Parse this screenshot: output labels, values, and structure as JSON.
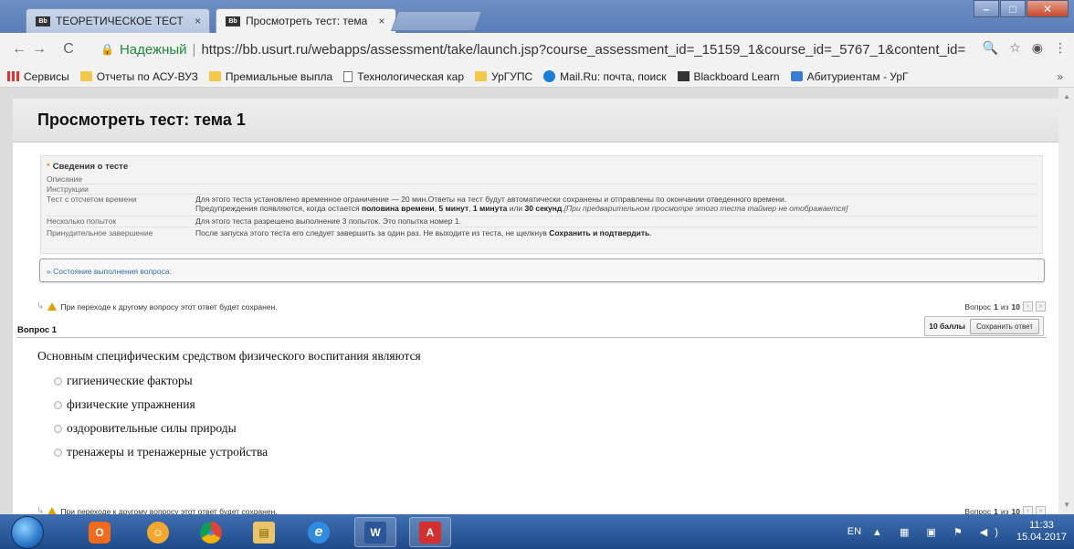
{
  "browser": {
    "tabs": [
      {
        "favicon": "Bb",
        "title": "ТЕОРЕТИЧЕСКОЕ ТЕСТИ",
        "close": "×"
      },
      {
        "favicon": "Bb",
        "title": "Просмотреть тест: тема",
        "close": "×"
      }
    ],
    "window_buttons": {
      "minimize": "–",
      "maximize": "□",
      "close": "✕"
    },
    "nav": {
      "back": "←",
      "forward": "→",
      "reload": "C"
    },
    "address": {
      "secure_label": "Надежный",
      "separator": "|",
      "url": "https://bb.usurt.ru/webapps/assessment/take/launch.jsp?course_assessment_id=_15159_1&course_id=_5767_1&content_id="
    },
    "toolbar_icons": {
      "zoom": "🔍",
      "star": "☆",
      "extension": "◉",
      "menu": "⋮"
    },
    "bookmarks": [
      {
        "icon": "apps-icon",
        "label": "Сервисы"
      },
      {
        "icon": "folder-icon",
        "label": "Отчеты по АСУ-ВУЗ"
      },
      {
        "icon": "folder-icon",
        "label": "Премиальные выпла"
      },
      {
        "icon": "page-icon",
        "label": "Технологическая кар"
      },
      {
        "icon": "folder-icon",
        "label": "УрГУПС"
      },
      {
        "icon": "mail-icon",
        "label": "Mail.Ru: почта, поиск"
      },
      {
        "icon": "blackboard-icon",
        "label": "Blackboard Learn"
      },
      {
        "icon": "abiturient-icon",
        "label": "Абитуриентам - УрГ"
      }
    ],
    "bookmarks_more": "»"
  },
  "page": {
    "title": "Просмотреть тест: тема 1",
    "info": {
      "heading": "Сведения о тесте",
      "rows": [
        {
          "key": "Описание",
          "value": ""
        },
        {
          "key": "Инструкции",
          "value": ""
        },
        {
          "key": "Тест с отсчетом времени",
          "value": "Для этого теста установлено временное ограничение — 20 мин.Ответы на тест будут автоматически сохранены и отправлены по окончании отведенного времени.",
          "value2_prefix": "Предупреждения появляются, когда остается ",
          "value2_b1": "половина времени",
          "value2_sep1": ", ",
          "value2_b2": "5 минут",
          "value2_sep2": ", ",
          "value2_b3": "1 минута",
          "value2_sep3": " или ",
          "value2_b4": "30 секунд",
          "value2_sep4": ".",
          "value2_italic": "[При предварительном просмотре этого теста таймер не отображается]"
        },
        {
          "key": "Несколько попыток",
          "value": "Для этого теста разрешено выполнение 3 попыток. Это попытка номер 1."
        },
        {
          "key": "Принудительное завершение",
          "value": "После запуска этого теста его следует завершить за один раз. Не выходите из теста, не щелкнув ",
          "value_bold": "Сохранить и подтвердить",
          "value_end": "."
        }
      ]
    },
    "status_toggle": "» Состояние выполнения вопроса:",
    "warning": "При переходе к другому вопросу этот ответ будет сохранен.",
    "pager": {
      "prefix": "Вопрос",
      "current": "1",
      "of": "из",
      "total": "10",
      "next": "›",
      "last": "»"
    },
    "question": {
      "heading": "Вопрос 1",
      "points": "10 баллы",
      "save_label": "Сохранить ответ",
      "text": "Основным специфическим средством физического воспитания являются",
      "options": [
        "гигиенические факторы",
        "физические упражнения",
        "оздоровительные силы природы",
        "тренажеры и тренажерные устройства"
      ]
    }
  },
  "taskbar": {
    "apps": [
      {
        "name": "origin",
        "glyph": "O"
      },
      {
        "name": "messenger",
        "glyph": "☺"
      },
      {
        "name": "chrome",
        "glyph": "●"
      },
      {
        "name": "explorer",
        "glyph": "▤"
      },
      {
        "name": "ie",
        "glyph": "e"
      },
      {
        "name": "word",
        "glyph": "W"
      },
      {
        "name": "acrobat",
        "glyph": "A"
      }
    ],
    "lang": "EN",
    "time": "11:33",
    "date": "15.04.2017"
  },
  "colors": {
    "secure_green": "#1f8a3a",
    "link_blue": "#3a6ea5",
    "warning_yellow": "#e0a000",
    "taskbar_blue": "#1f4a8a"
  }
}
